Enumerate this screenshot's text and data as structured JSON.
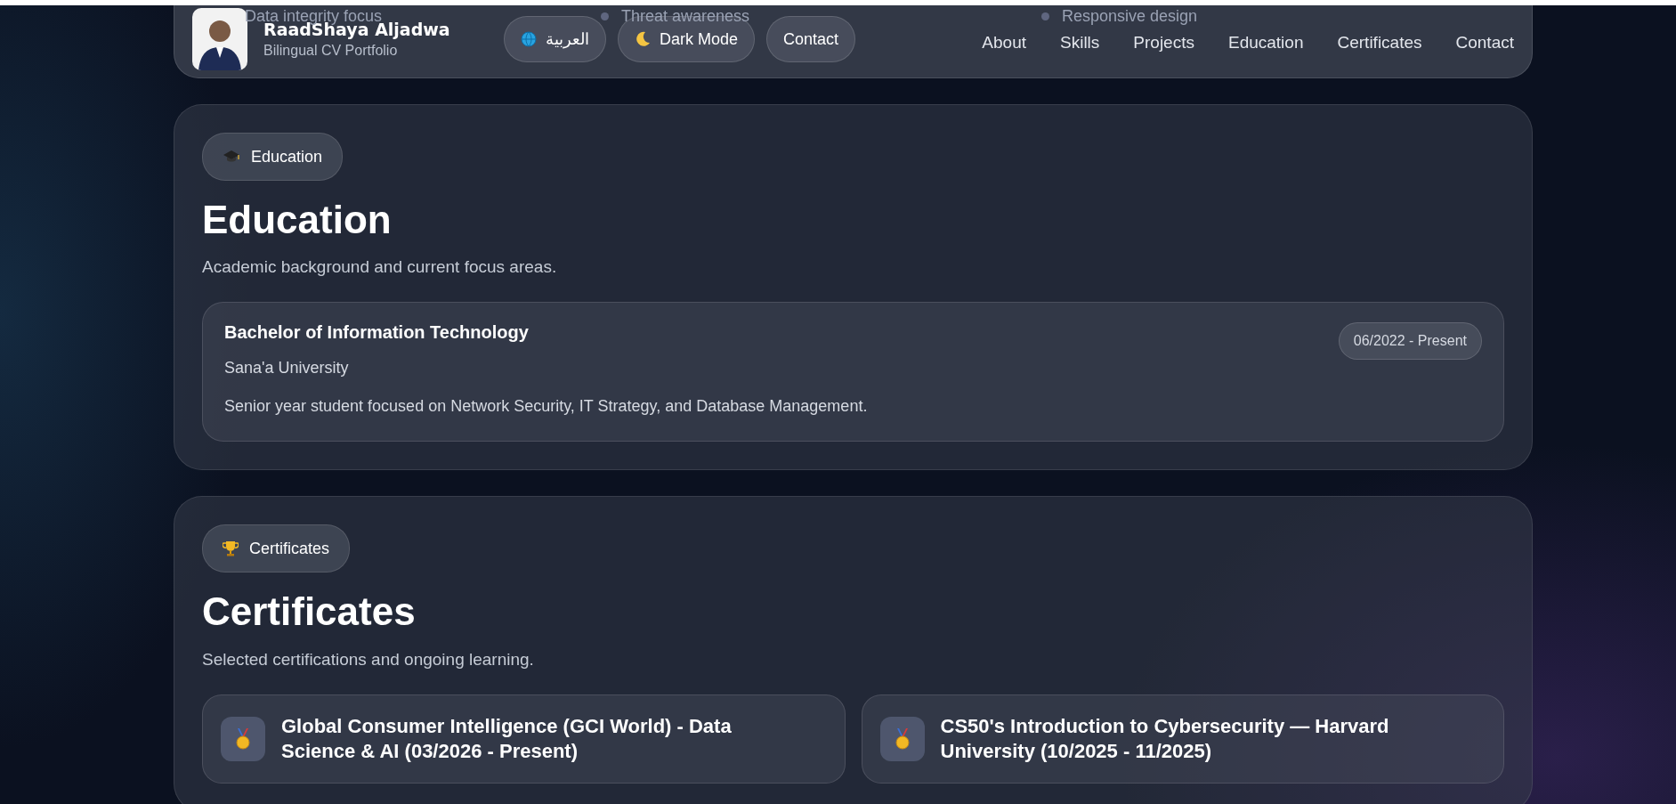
{
  "behind_header": [
    "Data integrity focus",
    "Threat awareness",
    "Responsive design"
  ],
  "header": {
    "name": "RaadShaya Aljadwa",
    "subtitle": "Bilingual CV Portfolio",
    "buttons": [
      {
        "kind": "globe",
        "label": "العربية"
      },
      {
        "kind": "moon",
        "label": "Dark Mode"
      },
      {
        "kind": "plain",
        "label": "Contact"
      }
    ],
    "nav": [
      "About",
      "Skills",
      "Projects",
      "Education",
      "Certificates",
      "Contact"
    ]
  },
  "sections": [
    {
      "kind": "education",
      "badge": "Education",
      "title": "Education",
      "subtitle": "Academic background and current focus areas.",
      "entries": [
        {
          "degree": "Bachelor of Information Technology",
          "school": "Sana'a University",
          "date": "06/2022 - Present",
          "description": "Senior year student focused on Network Security, IT Strategy, and Database Management."
        }
      ]
    },
    {
      "kind": "certificates",
      "badge": "Certificates",
      "title": "Certificates",
      "subtitle": "Selected certifications and ongoing learning.",
      "entries": [
        {
          "title": "Global Consumer Intelligence (GCI World) - Data Science & AI (03/2026 - Present)"
        },
        {
          "title": "CS50's Introduction to Cybersecurity — Harvard University (10/2025 - 11/2025)"
        }
      ]
    }
  ]
}
